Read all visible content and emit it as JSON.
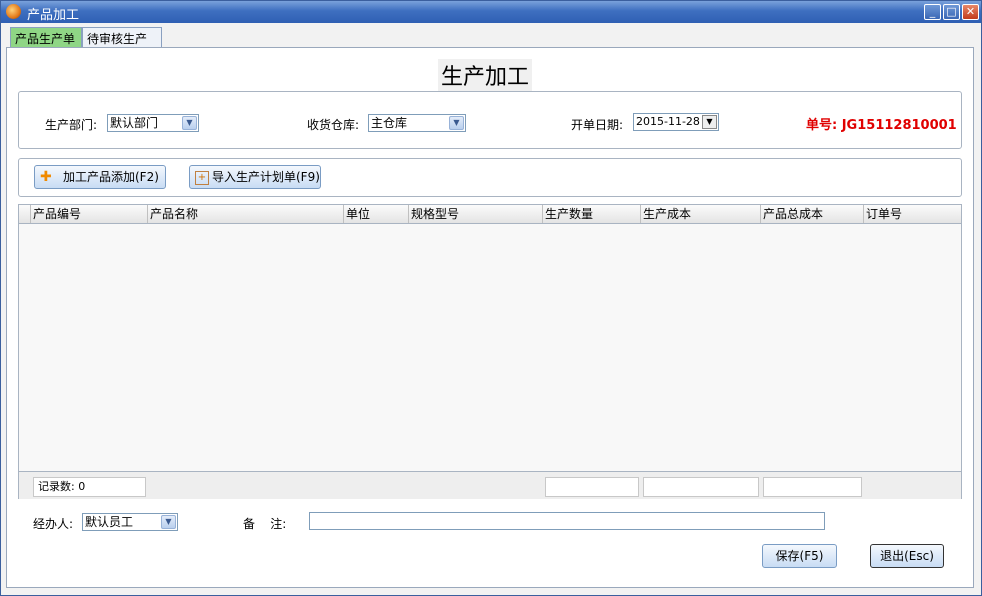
{
  "window": {
    "title": "产品加工",
    "controls": {
      "minimize": "_",
      "maximize": "□",
      "close": "✕"
    }
  },
  "tabs": [
    {
      "label": "产品生产单",
      "active": true
    },
    {
      "label": "待审核生产单",
      "active": false
    }
  ],
  "page_title": "生产加工",
  "header_form": {
    "dept_label": "生产部门:",
    "dept_value": "默认部门",
    "warehouse_label": "收货仓库:",
    "warehouse_value": "主仓库",
    "date_label": "开单日期:",
    "date_value": "2015-11-28",
    "order_no": "单号: JG15112810001"
  },
  "toolbar": {
    "add_button": "加工产品添加(F2)",
    "import_button": "导入生产计划单(F9)"
  },
  "grid": {
    "columns": [
      "产品编号",
      "产品名称",
      "单位",
      "规格型号",
      "生产数量",
      "生产成本",
      "产品总成本",
      "订单号"
    ],
    "rows": [],
    "record_count_label": "记录数: 0"
  },
  "footer_form": {
    "handler_label": "经办人:",
    "handler_value": "默认员工",
    "remark_label": "备    注:",
    "remark_value": ""
  },
  "actions": {
    "save": "保存(F5)",
    "exit": "退出(Esc)"
  },
  "colors": {
    "title_bar": "#3e6fc0",
    "active_tab": "#8fd685",
    "order_no": "#e00000",
    "button_gradient_end": "#c8dcf4"
  },
  "icons": {
    "app": "app-logo-icon",
    "add": "plus-icon",
    "import": "import-icon",
    "dropdown": "chevron-down-icon"
  }
}
